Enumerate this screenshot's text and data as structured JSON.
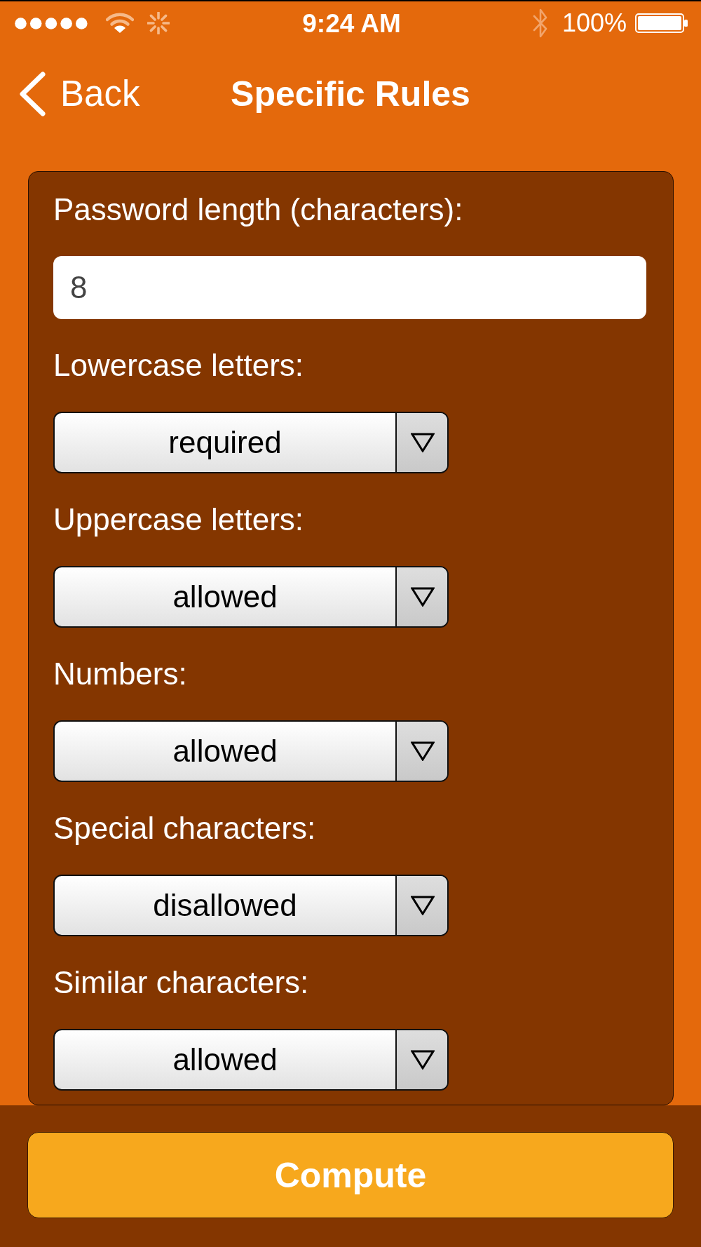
{
  "status_bar": {
    "time": "9:24 AM",
    "battery": "100%"
  },
  "nav_bar": {
    "back": "Back",
    "title": "Specific Rules"
  },
  "fields": [
    {
      "kind": "input",
      "label": "Password length (characters):",
      "value": "8"
    },
    {
      "kind": "select",
      "label": "Lowercase letters:",
      "value": "required"
    },
    {
      "kind": "select",
      "label": "Uppercase letters:",
      "value": "allowed"
    },
    {
      "kind": "select",
      "label": "Numbers:",
      "value": "allowed"
    },
    {
      "kind": "select",
      "label": "Special characters:",
      "value": "disallowed"
    },
    {
      "kind": "select",
      "label": "Similar characters:",
      "value": "allowed"
    }
  ],
  "compute_button": "Compute"
}
